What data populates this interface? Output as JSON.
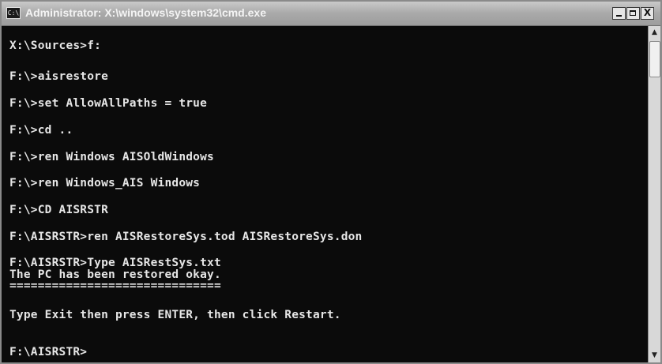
{
  "window": {
    "title": "Administrator: X:\\windows\\system32\\cmd.exe",
    "icon": "C:\\",
    "buttons": {
      "minimize_icon": "minimize-icon",
      "maximize_icon": "maximize-icon",
      "close_label": "X"
    }
  },
  "console": {
    "lines": [
      "X:\\Sources>f:",
      "F:\\>aisrestore",
      "F:\\>set AllowAllPaths = true",
      "F:\\>cd ..",
      "F:\\>ren Windows AISOldWindows",
      "F:\\>ren Windows_AIS Windows",
      "F:\\>CD AISRSTR",
      "F:\\AISRSTR>ren AISRestoreSys.tod AISRestoreSys.don",
      "F:\\AISRSTR>Type AISRestSys.txt",
      "The PC has been restored okay.",
      "==============================",
      "Type Exit then press ENTER, then click Restart.",
      "F:\\AISRSTR>"
    ]
  },
  "scrollbar": {
    "up_arrow": "▲",
    "down_arrow": "▼"
  },
  "colors": {
    "console_bg": "#0b0b0b",
    "console_text": "#e6e6e6",
    "titlebar": "#a9a9a9"
  }
}
